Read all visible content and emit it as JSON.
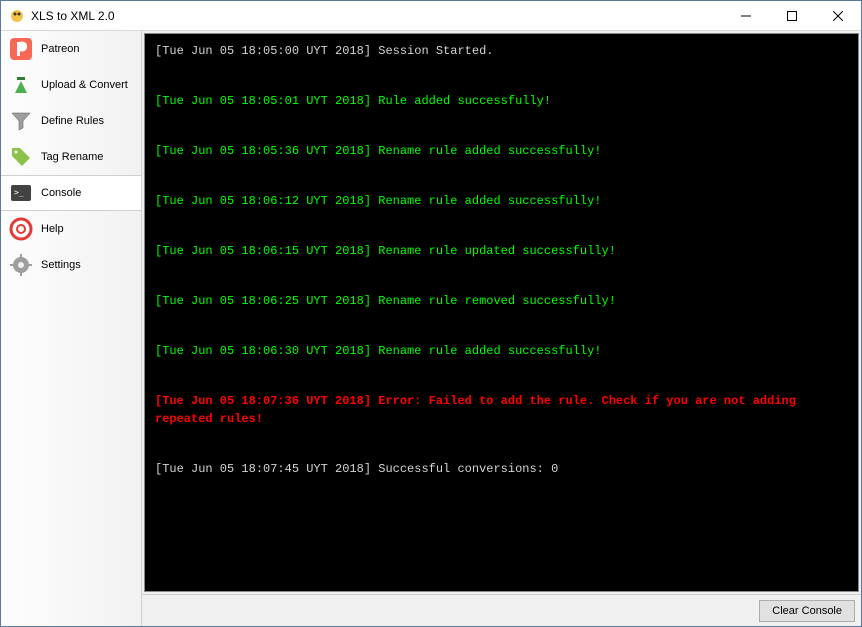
{
  "window": {
    "title": "XLS to XML 2.0"
  },
  "sidebar": {
    "items": [
      {
        "label": "Patreon"
      },
      {
        "label": "Upload & Convert"
      },
      {
        "label": "Define Rules"
      },
      {
        "label": "Tag Rename"
      },
      {
        "label": "Console"
      },
      {
        "label": "Help"
      },
      {
        "label": "Settings"
      }
    ]
  },
  "console": {
    "logs": [
      {
        "ts": "[Tue Jun 05 18:05:00 UYT 2018]",
        "msg": "Session Started.",
        "level": "white"
      },
      {
        "ts": "[Tue Jun 05 18:05:01 UYT 2018]",
        "msg": "Rule added successfully!",
        "level": "green"
      },
      {
        "ts": "[Tue Jun 05 18:05:36 UYT 2018]",
        "msg": "Rename rule added successfully!",
        "level": "green"
      },
      {
        "ts": "[Tue Jun 05 18:06:12 UYT 2018]",
        "msg": "Rename rule added successfully!",
        "level": "green"
      },
      {
        "ts": "[Tue Jun 05 18:06:15 UYT 2018]",
        "msg": "Rename rule updated successfully!",
        "level": "green"
      },
      {
        "ts": "[Tue Jun 05 18:06:25 UYT 2018]",
        "msg": "Rename rule removed successfully!",
        "level": "green"
      },
      {
        "ts": "[Tue Jun 05 18:06:30 UYT 2018]",
        "msg": "Rename rule added successfully!",
        "level": "green"
      },
      {
        "ts": "[Tue Jun 05 18:07:36 UYT 2018]",
        "msg": "Error: Failed to add the rule. Check if you are not adding repeated rules!",
        "level": "red"
      },
      {
        "ts": "[Tue Jun 05 18:07:45 UYT 2018]",
        "msg": "Successful conversions:  0",
        "level": "white"
      }
    ]
  },
  "footer": {
    "clear_label": "Clear Console"
  }
}
